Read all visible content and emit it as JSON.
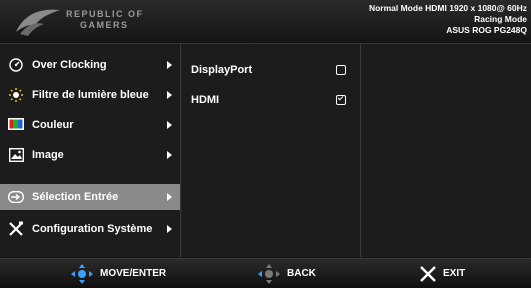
{
  "header": {
    "brand_line1": "REPUBLIC OF",
    "brand_line2": "GAMERS",
    "status_line1": "Normal Mode HDMI 1920 x 1080@ 60Hz",
    "status_line2": "Racing Mode",
    "status_line3": "ASUS ROG PG248Q"
  },
  "menu": {
    "items": [
      {
        "label": "Over Clocking",
        "icon": "speedometer-icon"
      },
      {
        "label": "Filtre de lumière bleue",
        "icon": "light-bulb-icon"
      },
      {
        "label": "Couleur",
        "icon": "color-palette-icon"
      },
      {
        "label": "Image",
        "icon": "image-icon"
      },
      {
        "label": "Sélection Entrée",
        "icon": "input-source-icon",
        "selected": true
      },
      {
        "label": "Configuration Système",
        "icon": "tools-icon"
      }
    ]
  },
  "submenu": {
    "items": [
      {
        "label": "DisplayPort",
        "checked": false
      },
      {
        "label": "HDMI",
        "checked": true
      }
    ]
  },
  "footer": {
    "move_label": "MOVE/ENTER",
    "back_label": "BACK",
    "exit_label": "EXIT"
  },
  "colors": {
    "selected_bg": "#8a8a8a",
    "nav_blue": "#3aa0ff"
  }
}
